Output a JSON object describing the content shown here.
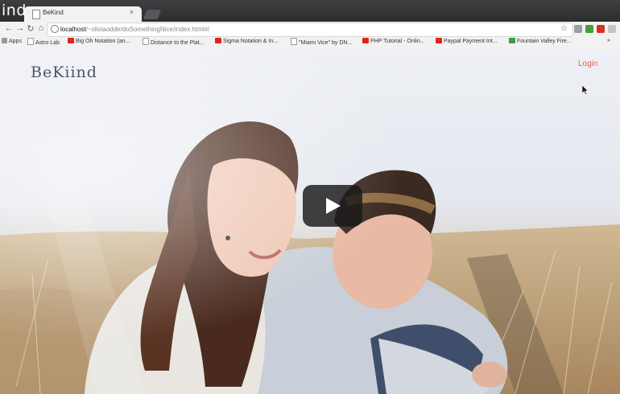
{
  "overlay": {
    "video_title_fragment": "ind"
  },
  "browser": {
    "tab_title": "BeKind",
    "tab_close": "×",
    "url_host": "localhost",
    "url_path": "/~oliviaodde/doSomethingNice/index.html#/",
    "bookmarks": [
      {
        "label": "Apps",
        "icon": "apps-icon"
      },
      {
        "label": "Astro Lab",
        "icon": "page-icon"
      },
      {
        "label": "Big Oh Notation (an...",
        "icon": "youtube-icon"
      },
      {
        "label": "Distance to the Plat...",
        "icon": "page-icon"
      },
      {
        "label": "Sigma Notation & In...",
        "icon": "youtube-icon"
      },
      {
        "label": "\"Miami Vice\" by DN...",
        "icon": "page-icon"
      },
      {
        "label": "PHP Tutorial - Onlin...",
        "icon": "youtube-icon"
      },
      {
        "label": "Paypal Payment Int...",
        "icon": "youtube-icon"
      },
      {
        "label": "Fountain Valley Fire...",
        "icon": "green-icon"
      }
    ]
  },
  "site": {
    "brand": "BeKiind",
    "login": "Login"
  },
  "colors": {
    "login": "#e0604a",
    "brand": "#4a5566",
    "youtube": "#e62117"
  }
}
